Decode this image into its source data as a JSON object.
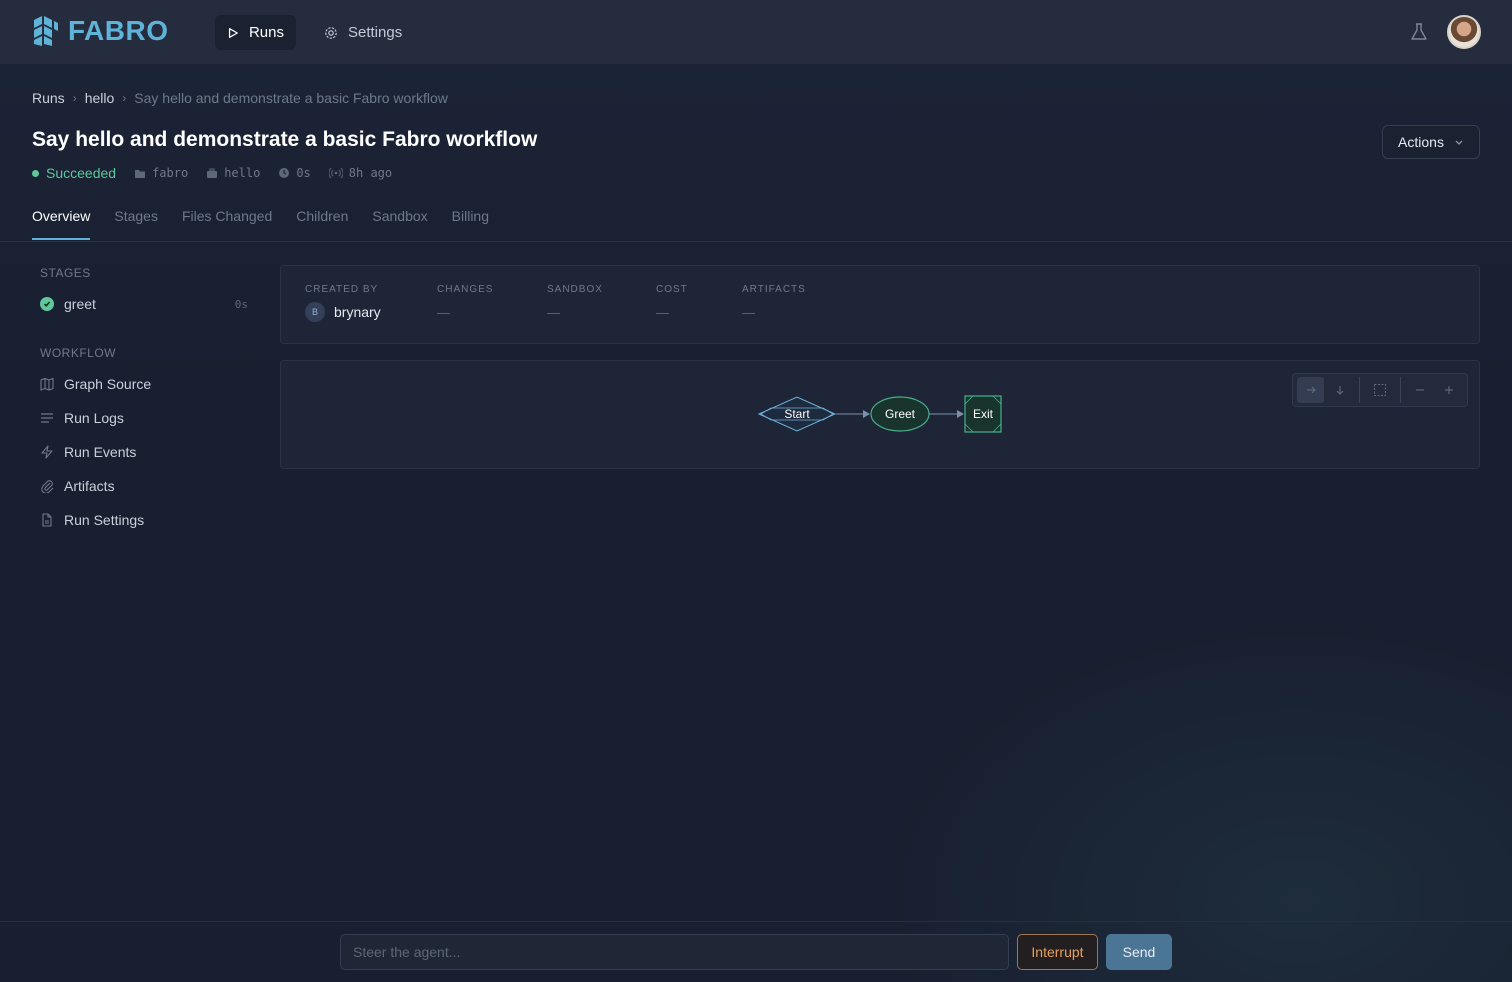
{
  "nav": {
    "logo_text": "FABRO",
    "runs_label": "Runs",
    "settings_label": "Settings"
  },
  "breadcrumb": {
    "root": "Runs",
    "workflow": "hello",
    "current": "Say hello and demonstrate a basic Fabro workflow"
  },
  "page": {
    "title": "Say hello and demonstrate a basic Fabro workflow",
    "actions_label": "Actions"
  },
  "meta": {
    "status": "Succeeded",
    "repo": "fabro",
    "workflow": "hello",
    "duration": "0s",
    "age": "8h ago"
  },
  "tabs": [
    "Overview",
    "Stages",
    "Files Changed",
    "Children",
    "Sandbox",
    "Billing"
  ],
  "sidebar": {
    "stages_heading": "STAGES",
    "stages": [
      {
        "label": "greet",
        "duration": "0s"
      }
    ],
    "workflow_heading": "WORKFLOW",
    "workflow_items": [
      {
        "label": "Graph Source",
        "icon": "map-icon"
      },
      {
        "label": "Run Logs",
        "icon": "lines-icon"
      },
      {
        "label": "Run Events",
        "icon": "bolt-icon"
      },
      {
        "label": "Artifacts",
        "icon": "paperclip-icon"
      },
      {
        "label": "Run Settings",
        "icon": "file-icon"
      }
    ]
  },
  "info": {
    "created_by_label": "CREATED BY",
    "creator_initial": "B",
    "creator_name": "brynary",
    "changes_label": "CHANGES",
    "changes_value": "—",
    "sandbox_label": "SANDBOX",
    "sandbox_value": "—",
    "cost_label": "COST",
    "cost_value": "—",
    "artifacts_label": "ARTIFACTS",
    "artifacts_value": "—"
  },
  "graph": {
    "nodes": [
      "Start",
      "Greet",
      "Exit"
    ]
  },
  "composer": {
    "placeholder": "Steer the agent...",
    "interrupt_label": "Interrupt",
    "send_label": "Send"
  },
  "colors": {
    "accent": "#5fb3d9",
    "success": "#5ec89a",
    "warning": "#e6a15c"
  }
}
